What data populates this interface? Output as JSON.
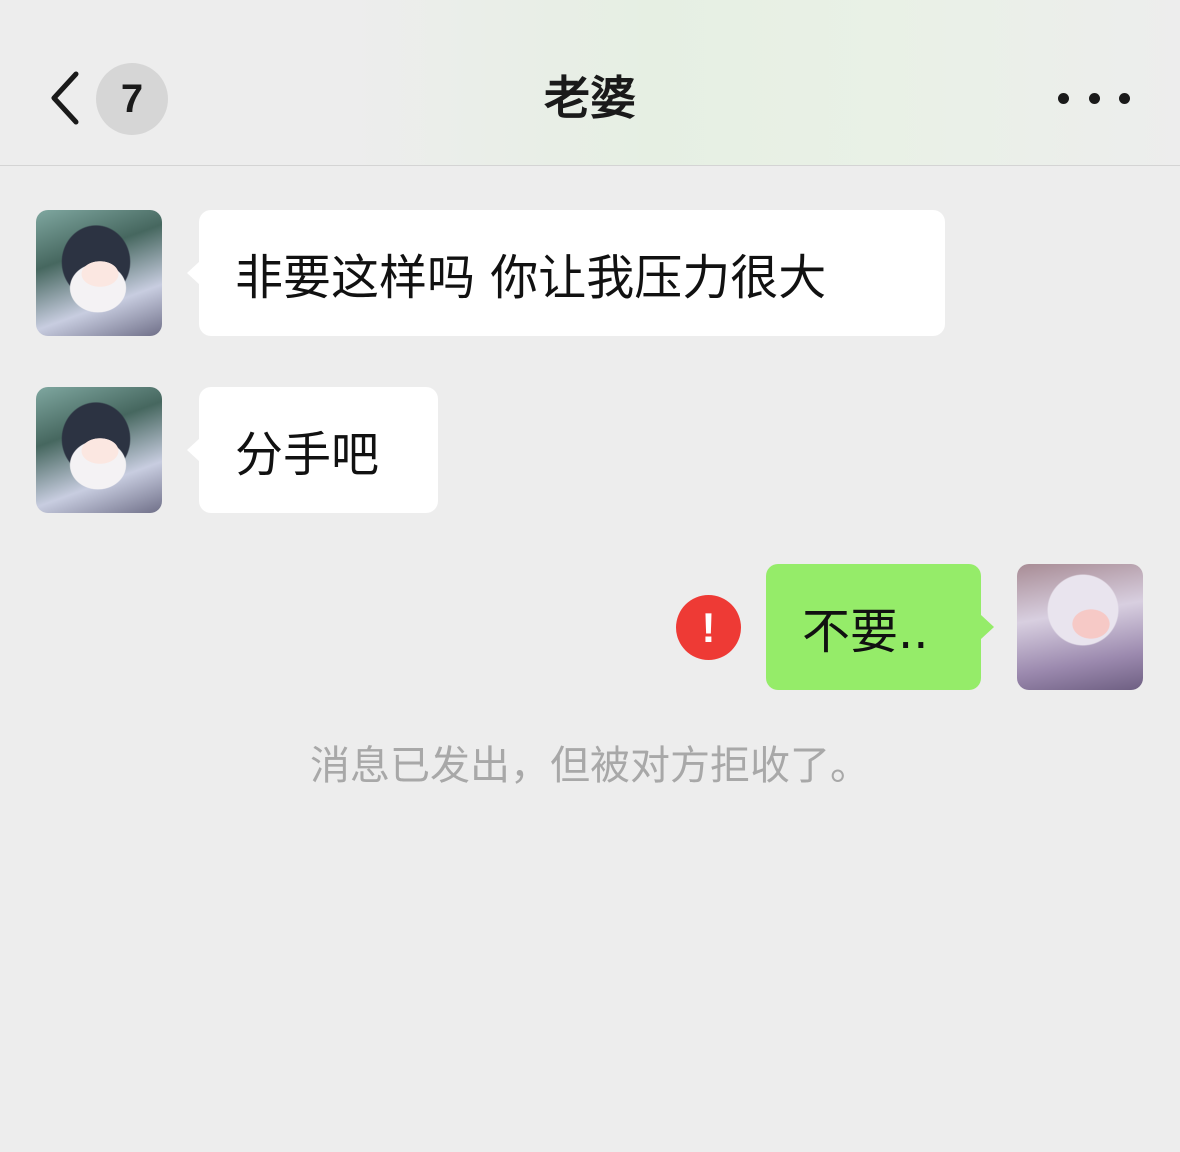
{
  "header": {
    "back_icon": "chevron-left-icon",
    "unread_count": "7",
    "title": "老婆",
    "more_icon": "ellipsis-icon"
  },
  "messages": [
    {
      "direction": "incoming",
      "text": "非要这样吗 你让我压力很大"
    },
    {
      "direction": "incoming",
      "text": "分手吧"
    },
    {
      "direction": "outgoing",
      "text": "不要..",
      "status_icon": "!"
    }
  ],
  "system_note": "消息已发出，但被对方拒收了。",
  "colors": {
    "background": "#ededed",
    "incoming_bubble": "#ffffff",
    "outgoing_bubble": "#95ec69",
    "error": "#ee3a35",
    "note_text": "#a8a8a8"
  }
}
